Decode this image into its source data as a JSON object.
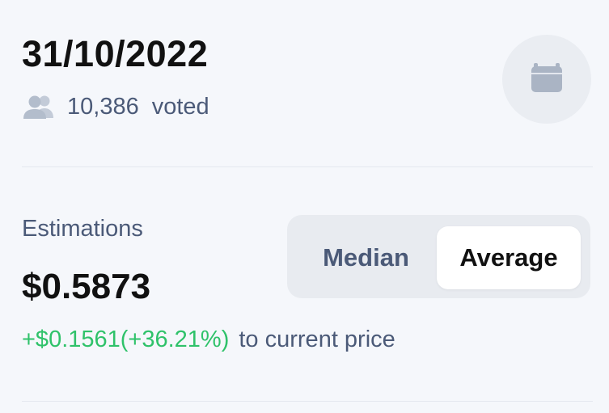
{
  "header": {
    "date": "31/10/2022",
    "voted_count": "10,386",
    "voted_label": "voted",
    "icons": {
      "users": "users-icon",
      "calendar": "calendar-icon"
    }
  },
  "estimations": {
    "label": "Estimations",
    "value": "$0.5873",
    "change": "+$0.1561(+36.21%)",
    "change_suffix": "to current price",
    "toggle": {
      "options": [
        "Median",
        "Average"
      ],
      "selected": "Average"
    }
  },
  "colors": {
    "background": "#f5f7fb",
    "text_primary": "#111111",
    "text_secondary": "#4b5a78",
    "positive": "#2fc26a",
    "icon_gray": "#b3bdcc",
    "toggle_bg": "#e8ebf0",
    "toggle_active_bg": "#ffffff"
  }
}
